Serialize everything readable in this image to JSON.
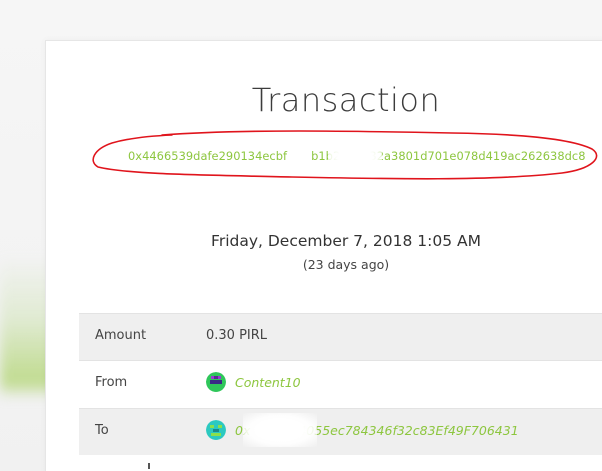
{
  "page": {
    "title": "Transaction",
    "hash": "0x4466539dafe290134ecbf",
    "hash_tail": "b1b28b1d32a3801d701e078d419ac262638dc8",
    "date": "Friday, December 7, 2018 1:05 AM",
    "ago": "(23 days ago)"
  },
  "details": {
    "amount_label": "Amount",
    "amount_value": "0.30 PIRL",
    "from_label": "From",
    "from_value": "Content10",
    "to_label": "To",
    "to_prefix": "0x",
    "to_value": "4055ec784346f32c83Ef49F706431"
  },
  "colors": {
    "link": "#8dc63f",
    "annotation": "#e0141c"
  },
  "icons": {
    "from": "identicon-avatar",
    "to": "identicon-avatar"
  }
}
